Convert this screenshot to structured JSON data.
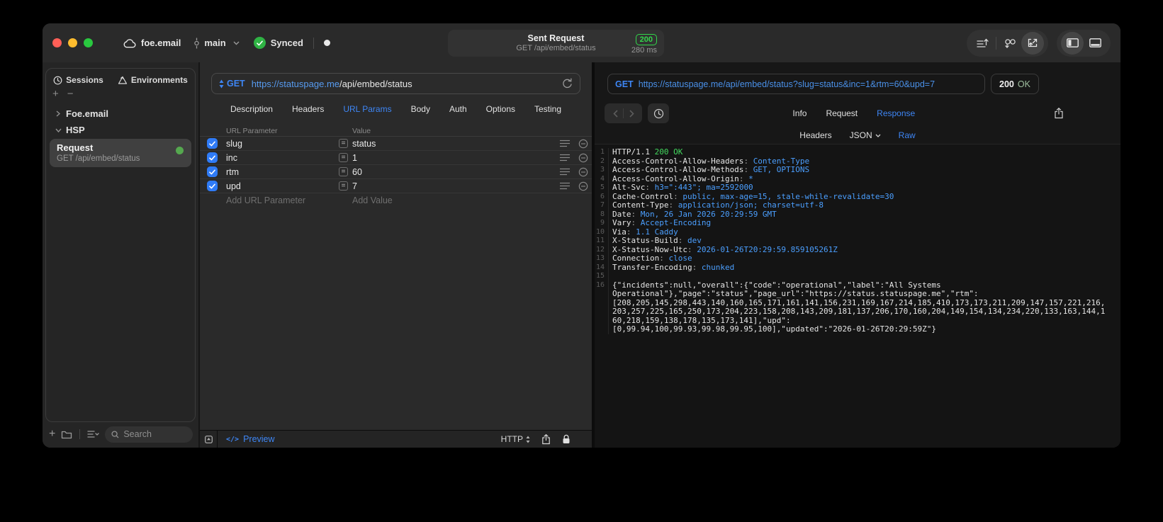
{
  "titlebar": {
    "project": "foe.email",
    "branch": "main",
    "sync_status": "Synced",
    "request_summary": {
      "title": "Sent Request",
      "subtitle": "GET /api/embed/status",
      "status_code": "200",
      "duration": "280 ms"
    }
  },
  "sidebar": {
    "tabs": [
      {
        "label": "Sessions",
        "icon": "history-clock-icon"
      },
      {
        "label": "Environments",
        "icon": "environments-icon"
      }
    ],
    "tree": [
      {
        "label": "Foe.email",
        "expanded": false
      },
      {
        "label": "HSP",
        "expanded": true
      }
    ],
    "request_item": {
      "title": "Request",
      "subtitle": "GET /api/embed/status",
      "status_dot_color": "#55a84f"
    },
    "search_placeholder": "Search"
  },
  "request": {
    "method": "GET",
    "url_host": "https://statuspage.me",
    "url_path": "/api/embed/status",
    "tabs": [
      {
        "label": "Description"
      },
      {
        "label": "Headers"
      },
      {
        "label": "URL Params",
        "active": true
      },
      {
        "label": "Body"
      },
      {
        "label": "Auth"
      },
      {
        "label": "Options"
      },
      {
        "label": "Testing"
      }
    ],
    "params": {
      "columns": {
        "name": "URL Parameter",
        "value": "Value"
      },
      "rows": [
        {
          "name": "slug",
          "value": "status",
          "enabled": true
        },
        {
          "name": "inc",
          "value": "1",
          "enabled": true
        },
        {
          "name": "rtm",
          "value": "60",
          "enabled": true
        },
        {
          "name": "upd",
          "value": "7",
          "enabled": true
        }
      ],
      "add_name_placeholder": "Add URL Parameter",
      "add_value_placeholder": "Add Value"
    },
    "footer": {
      "preview_label": "Preview",
      "code_glyph": "</>",
      "protocol_label": "HTTP"
    }
  },
  "response": {
    "request_line": {
      "method": "GET",
      "url": "https://statuspage.me/api/embed/status?slug=status&inc=1&rtm=60&upd=7"
    },
    "status": {
      "code": "200",
      "text": "OK"
    },
    "tabs": [
      {
        "label": "Info"
      },
      {
        "label": "Request"
      },
      {
        "label": "Response",
        "active": true
      }
    ],
    "view_tabs": [
      {
        "label": "Headers"
      },
      {
        "label": "JSON",
        "dropdown": true
      },
      {
        "label": "Raw",
        "active": true
      }
    ],
    "body_lines": [
      {
        "num": "1",
        "parts": [
          [
            "HTTP/1.1 ",
            "w"
          ],
          [
            "200 OK",
            "g"
          ]
        ]
      },
      {
        "num": "2",
        "parts": [
          [
            "Access-Control-Allow-Headers",
            "w"
          ],
          [
            ": ",
            "d"
          ],
          [
            "Content-Type",
            "b"
          ]
        ]
      },
      {
        "num": "3",
        "parts": [
          [
            "Access-Control-Allow-Methods",
            "w"
          ],
          [
            ": ",
            "d"
          ],
          [
            "GET, OPTIONS",
            "b"
          ]
        ]
      },
      {
        "num": "4",
        "parts": [
          [
            "Access-Control-Allow-Origin",
            "w"
          ],
          [
            ": ",
            "d"
          ],
          [
            "*",
            "b"
          ]
        ]
      },
      {
        "num": "5",
        "parts": [
          [
            "Alt-Svc",
            "w"
          ],
          [
            ": ",
            "d"
          ],
          [
            "h3=\":443\"; ma=2592000",
            "b"
          ]
        ]
      },
      {
        "num": "6",
        "parts": [
          [
            "Cache-Control",
            "w"
          ],
          [
            ": ",
            "d"
          ],
          [
            "public, max-age=15, stale-while-revalidate=30",
            "b"
          ]
        ]
      },
      {
        "num": "7",
        "parts": [
          [
            "Content-Type",
            "w"
          ],
          [
            ": ",
            "d"
          ],
          [
            "application/json; charset=utf-8",
            "b"
          ]
        ]
      },
      {
        "num": "8",
        "parts": [
          [
            "Date",
            "w"
          ],
          [
            ": ",
            "d"
          ],
          [
            "Mon, 26 Jan 2026 20:29:59 GMT",
            "b"
          ]
        ]
      },
      {
        "num": "9",
        "parts": [
          [
            "Vary",
            "w"
          ],
          [
            ": ",
            "d"
          ],
          [
            "Accept-Encoding",
            "b"
          ]
        ]
      },
      {
        "num": "10",
        "parts": [
          [
            "Via",
            "w"
          ],
          [
            ": ",
            "d"
          ],
          [
            "1.1 Caddy",
            "b"
          ]
        ]
      },
      {
        "num": "11",
        "parts": [
          [
            "X-Status-Build",
            "w"
          ],
          [
            ": ",
            "d"
          ],
          [
            "dev",
            "b"
          ]
        ]
      },
      {
        "num": "12",
        "parts": [
          [
            "X-Status-Now-Utc",
            "w"
          ],
          [
            ": ",
            "d"
          ],
          [
            "2026-01-26T20:29:59.859105261Z",
            "b"
          ]
        ]
      },
      {
        "num": "13",
        "parts": [
          [
            "Connection",
            "w"
          ],
          [
            ": ",
            "d"
          ],
          [
            "close",
            "b"
          ]
        ]
      },
      {
        "num": "14",
        "parts": [
          [
            "Transfer-Encoding",
            "w"
          ],
          [
            ": ",
            "d"
          ],
          [
            "chunked",
            "b"
          ]
        ]
      },
      {
        "num": "15",
        "parts": []
      },
      {
        "num": "16",
        "parts": [
          [
            "{\"incidents\":null,\"overall\":{\"code\":\"operational\",\"label\":\"All Systems",
            "w"
          ]
        ]
      },
      {
        "num": "",
        "parts": [
          [
            "Operational\"},\"page\":\"status\",\"page_url\":\"https://status.statuspage.me\",\"rtm\":",
            "w"
          ]
        ]
      },
      {
        "num": "",
        "parts": [
          [
            "[208,205,145,298,443,140,160,165,171,161,141,156,231,169,167,214,185,410,173,173,211,209,147,157,221,216,",
            "w"
          ]
        ]
      },
      {
        "num": "",
        "parts": [
          [
            "203,257,225,165,250,173,204,223,158,208,143,209,181,137,206,170,160,204,149,154,134,234,220,133,163,144,1",
            "w"
          ]
        ]
      },
      {
        "num": "",
        "parts": [
          [
            "60,218,159,138,178,135,173,141],\"upd\":",
            "w"
          ]
        ]
      },
      {
        "num": "",
        "parts": [
          [
            "[0,99.94,100,99.93,99.98,99.95,100],\"updated\":\"2026-01-26T20:29:59Z\"}",
            "w"
          ]
        ]
      }
    ]
  },
  "colors": {
    "accent_blue": "#3e86f5",
    "status_green": "#32d74b",
    "code_value_blue": "#4b9fff",
    "code_status_green": "#43d95e",
    "checkbox_blue": "#2f7bf6",
    "traffic_red": "#ff5f57",
    "traffic_yellow": "#febc2e",
    "traffic_green": "#29c83f"
  }
}
